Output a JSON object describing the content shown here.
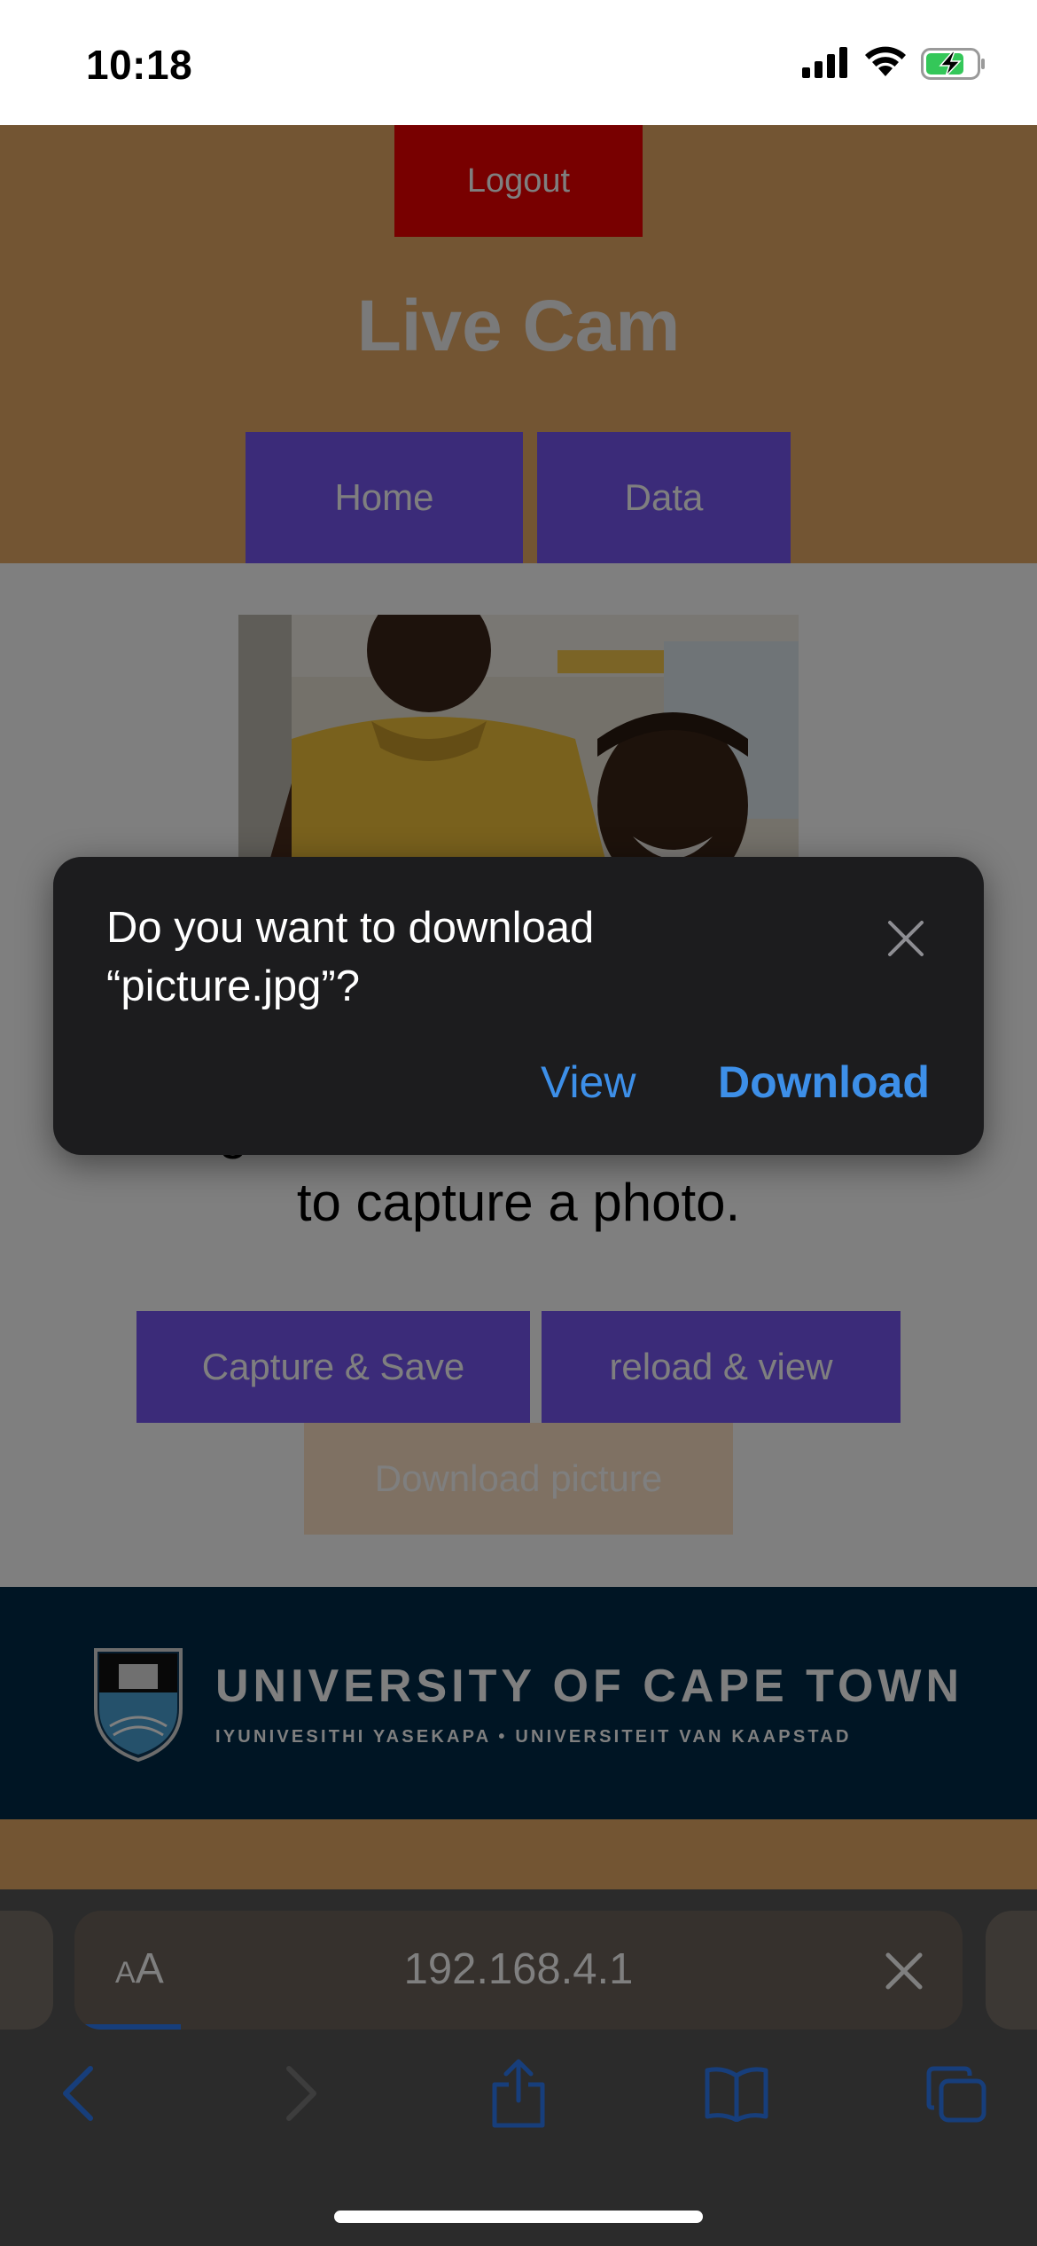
{
  "status_bar": {
    "time": "10:18",
    "signal_icon": "cellular-signal-icon",
    "wifi_icon": "wifi-icon",
    "battery_icon": "battery-charging-icon"
  },
  "header": {
    "logout_label": "Logout",
    "title": "Live Cam",
    "nav": [
      {
        "label": "Home"
      },
      {
        "label": "Data"
      }
    ]
  },
  "content": {
    "camera_image_alt": "camera-preview",
    "hint_visible": "to capture a photo.",
    "hint_partial": "It might take more than 5 seconds",
    "buttons": {
      "capture": "Capture & Save",
      "reload": "reload & view",
      "download": "Download picture"
    }
  },
  "footer": {
    "university_name": "UNIVERSITY OF CAPE TOWN",
    "university_subtitle": "IYUNIVESITHI YASEKAPA • UNIVERSITEIT VAN KAAPSTAD"
  },
  "popup": {
    "message": "Do you want to download “picture.jpg”?",
    "view_label": "View",
    "download_label": "Download"
  },
  "safari": {
    "aa_small": "A",
    "aa_big": "A",
    "url": "192.168.4.1",
    "load_progress": 0.12
  },
  "colors": {
    "header_bg": "#e6aa67",
    "logout_bg": "#f00000",
    "button_purple": "#7657f2",
    "download_button_bg": "#ffe3c6",
    "footer_bg": "#002b49",
    "popup_bg": "#1c1c1e",
    "accent_blue": "#3d8fe8"
  }
}
